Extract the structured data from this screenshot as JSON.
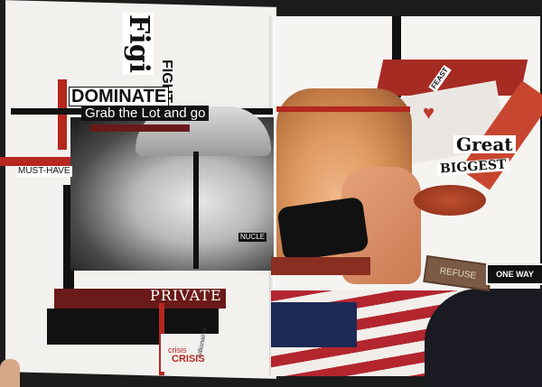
{
  "collage": {
    "left_page": {
      "fight_vertical": "Figi",
      "fight_word": "FIGHT",
      "dominate": "DOMINATE",
      "grab": "Grab the Lot and go",
      "must_have": "MUST-HAVE",
      "private": "PRIVATE",
      "nucle": "NUCLE",
      "crisis1": "crisis",
      "crisis2": "CRISIS",
      "billionaires": "billionaires"
    },
    "right_page": {
      "feast": "FEAST",
      "great": "Great",
      "biggest": "BIGGEST",
      "refuse": "REFUSE",
      "one_way": "ONE WAY"
    }
  },
  "colors": {
    "accent_red": "#a62b23",
    "black": "#111111",
    "paper": "#f3f1ee"
  }
}
